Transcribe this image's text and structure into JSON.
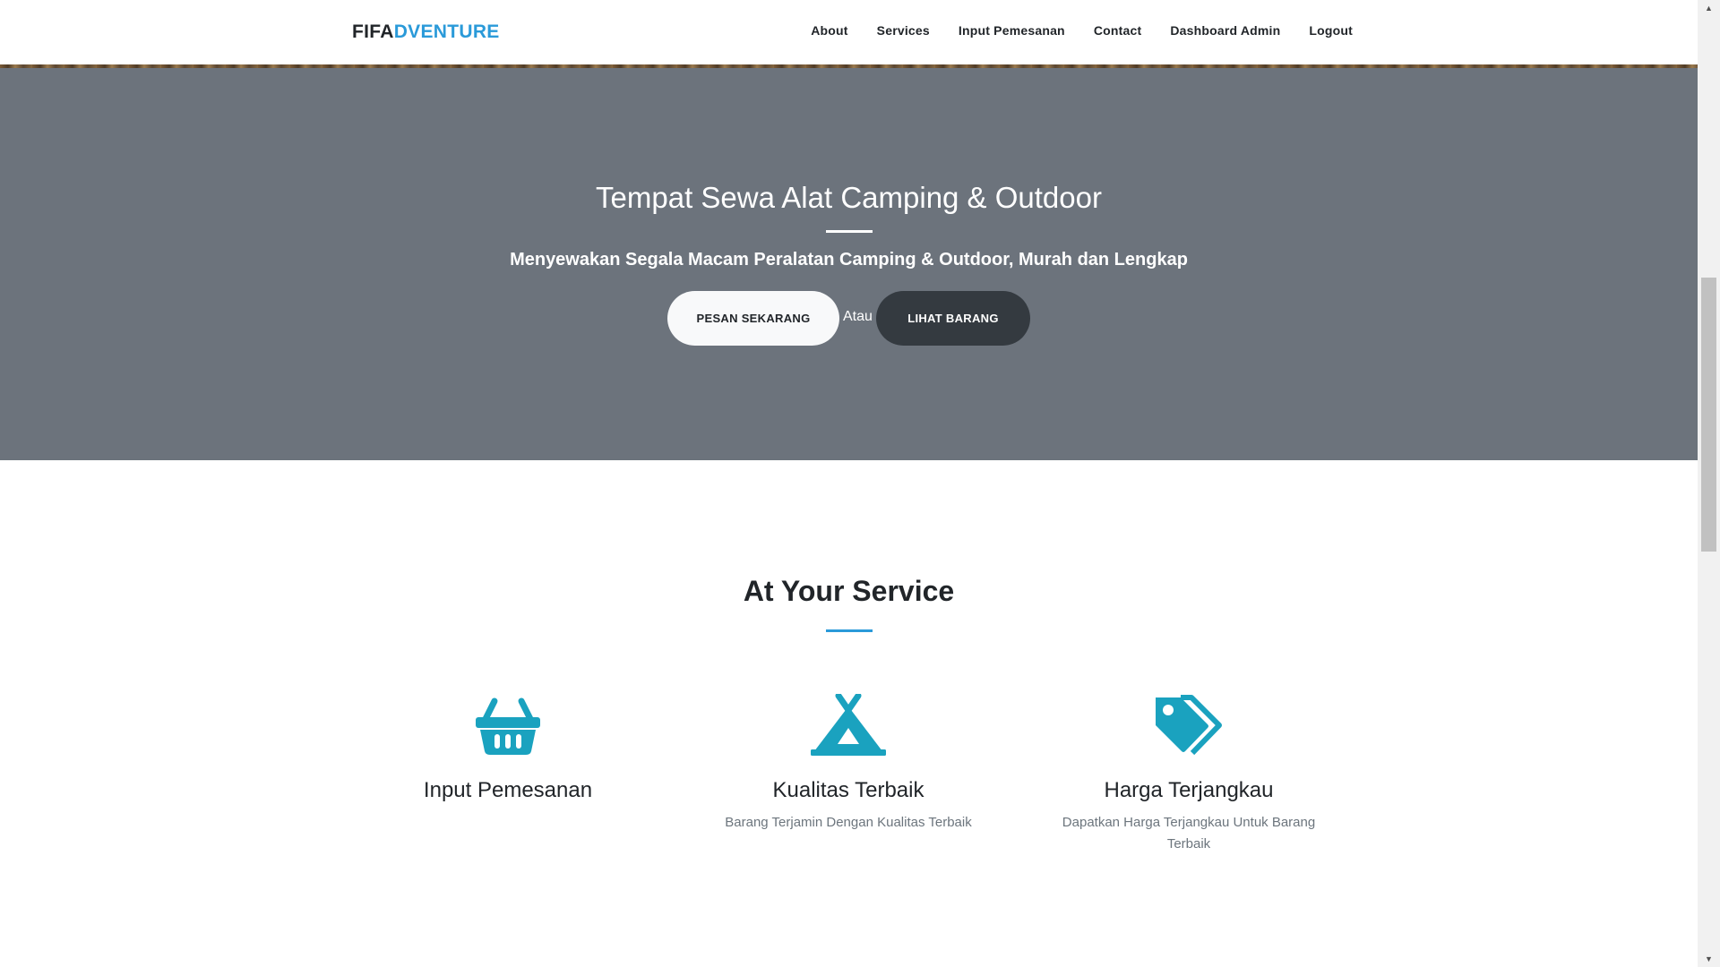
{
  "navbar": {
    "brand_part1": "FIFA",
    "brand_part2": "DVENTURE",
    "items": [
      {
        "label": "About"
      },
      {
        "label": "Services"
      },
      {
        "label": "Input Pemesanan"
      },
      {
        "label": "Contact"
      },
      {
        "label": "Dashboard Admin"
      },
      {
        "label": "Logout"
      }
    ]
  },
  "hero": {
    "title": "Tempat Sewa Alat Camping & Outdoor",
    "subtitle": "Menyewakan Segala Macam Peralatan Camping & Outdoor, Murah dan Lengkap",
    "primary_button": "PESAN SEKARANG",
    "separator_text": "Atau",
    "secondary_button": "LIHAT BARANG"
  },
  "services": {
    "title": "At Your Service",
    "items": [
      {
        "icon": "basket-icon",
        "title": "Input Pemesanan",
        "description": ""
      },
      {
        "icon": "tent-icon",
        "title": "Kualitas Terbaik",
        "description": "Barang Terjamin Dengan Kualitas Terbaik"
      },
      {
        "icon": "tags-icon",
        "title": "Harga Terjangkau",
        "description": "Dapatkan Harga Terjangkau Untuk Barang Terbaik"
      }
    ]
  },
  "colors": {
    "accent": "#2a9ad9",
    "icon": "#1aa2bf",
    "hero_overlay": "#6c737c",
    "dark_button": "#343a40"
  }
}
